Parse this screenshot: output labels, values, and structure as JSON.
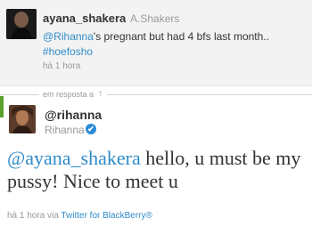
{
  "parent_tweet": {
    "handle": "ayana_shakera",
    "display_name": "A.Shakers",
    "mention": "@Rihanna",
    "text_after_mention": "'s pregnant but had 4 bfs last month..",
    "hashtag": "#hoefosho",
    "time": "há 1 hora"
  },
  "reply_separator": {
    "label": "em resposta a",
    "arrow": "↑"
  },
  "main_tweet": {
    "handle": "@rihanna",
    "name": "Rihanna",
    "verified_glyph": "✔",
    "mention": "@ayana_shakera",
    "text": " hello, u must be my pussy! Nice to meet u",
    "time": "há 1 hora",
    "via": "via",
    "client": "Twitter for BlackBerry®"
  },
  "colors": {
    "link": "#2f8bc9",
    "accent_green": "#5aa02c",
    "verified_blue": "#2b8bd6"
  }
}
